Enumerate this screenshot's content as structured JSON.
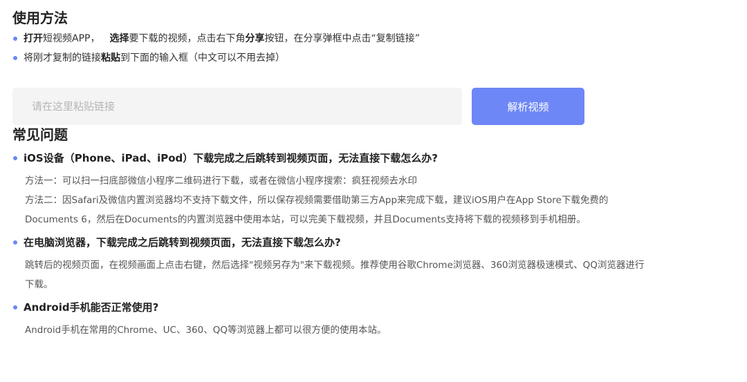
{
  "usage": {
    "title": "使用方法",
    "step1": {
      "b1": "打开",
      "t1": "短视频APP，",
      "b2": "选择",
      "t2": "要下载的视频，点击右下角",
      "b3": "分享",
      "t3": "按钮，在分享弹框中点击“复制链接”"
    },
    "step2": {
      "t1": "将刚才复制的链接",
      "b1": "粘贴",
      "t2": "到下面的输入框（中文可以不用去掉）"
    }
  },
  "form": {
    "placeholder": "请在这里粘贴链接",
    "button": "解析视频"
  },
  "faq": {
    "title": "常见问题",
    "items": [
      {
        "question": "iOS设备（Phone、iPad、iPod）下载完成之后跳转到视频页面，无法直接下载怎么办?",
        "lines": [
          "方法一：可以扫一扫底部微信小程序二维码进行下载，或者在微信小程序搜索：疯狂视频去水印",
          "方法二：因Safari及微信内置浏览器均不支持下载文件，所以保存视频需要借助第三方App来完成下载，建议iOS用户在App Store下载免费的",
          "Documents 6，然后在Documents的内置浏览器中使用本站，可以完美下载视频，并且Documents支持将下载的视频移到手机相册。"
        ]
      },
      {
        "question": "在电脑浏览器，下载完成之后跳转到视频页面，无法直接下载怎么办?",
        "lines": [
          "跳转后的视频页面，在视频画面上点击右键，然后选择\"视频另存为\"来下载视频。推荐使用谷歌Chrome浏览器、360浏览器极速模式、QQ浏览器进行",
          "下载。"
        ]
      },
      {
        "question": "Android手机能否正常使用?",
        "lines": [
          "Android手机在常用的Chrome、UC、360、QQ等浏览器上都可以很方便的使用本站。"
        ]
      }
    ]
  },
  "colors": {
    "accent": "#6d87f6",
    "input_bg": "#f4f4f4",
    "bullet": "#6b86f6"
  }
}
